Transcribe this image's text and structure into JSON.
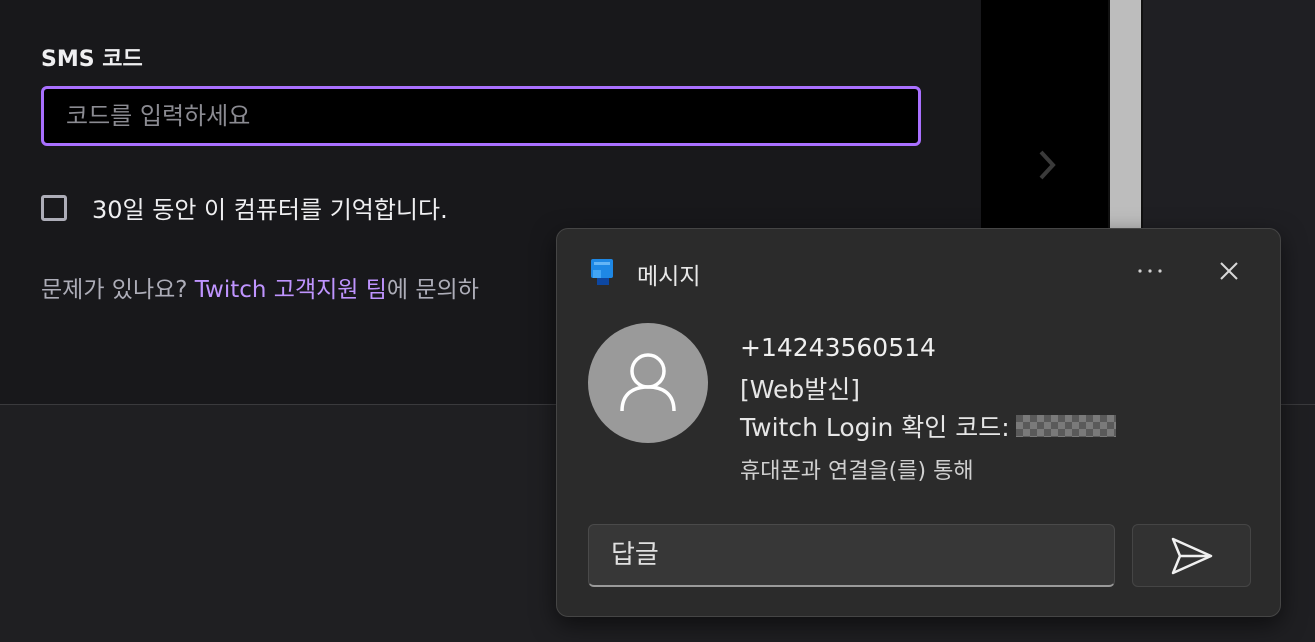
{
  "form": {
    "sms_label": "SMS 코드",
    "code_placeholder": "코드를 입력하세요",
    "code_value": "",
    "remember_label": "30일 동안 이 컴퓨터를 기억합니다.",
    "remember_checked": false,
    "help_prefix": "문제가 있나요? ",
    "help_link": "Twitch 고객지원 팀",
    "help_suffix": "에 문의하"
  },
  "background": {
    "next_icon": "chevron-right-icon",
    "scrollbar": "vertical-scrollbar"
  },
  "notification": {
    "app_icon": "messages-app-icon",
    "app_name": "메시지",
    "more_icon": "ellipsis-icon",
    "close_icon": "close-icon",
    "avatar_icon": "person-icon",
    "sender": "+14243560514",
    "line1": "[Web발신]",
    "line2": "Twitch Login 확인 코드:",
    "code_redacted": true,
    "via": "휴대폰과 연결을(를) 통해",
    "reply_placeholder": "답글",
    "send_icon": "send-icon"
  },
  "colors": {
    "accent": "#a970ff",
    "link": "#bf94ff",
    "page_bg": "#18181b",
    "toast_bg": "#2b2b2b",
    "app_icon_blue": "#1e88e5"
  }
}
